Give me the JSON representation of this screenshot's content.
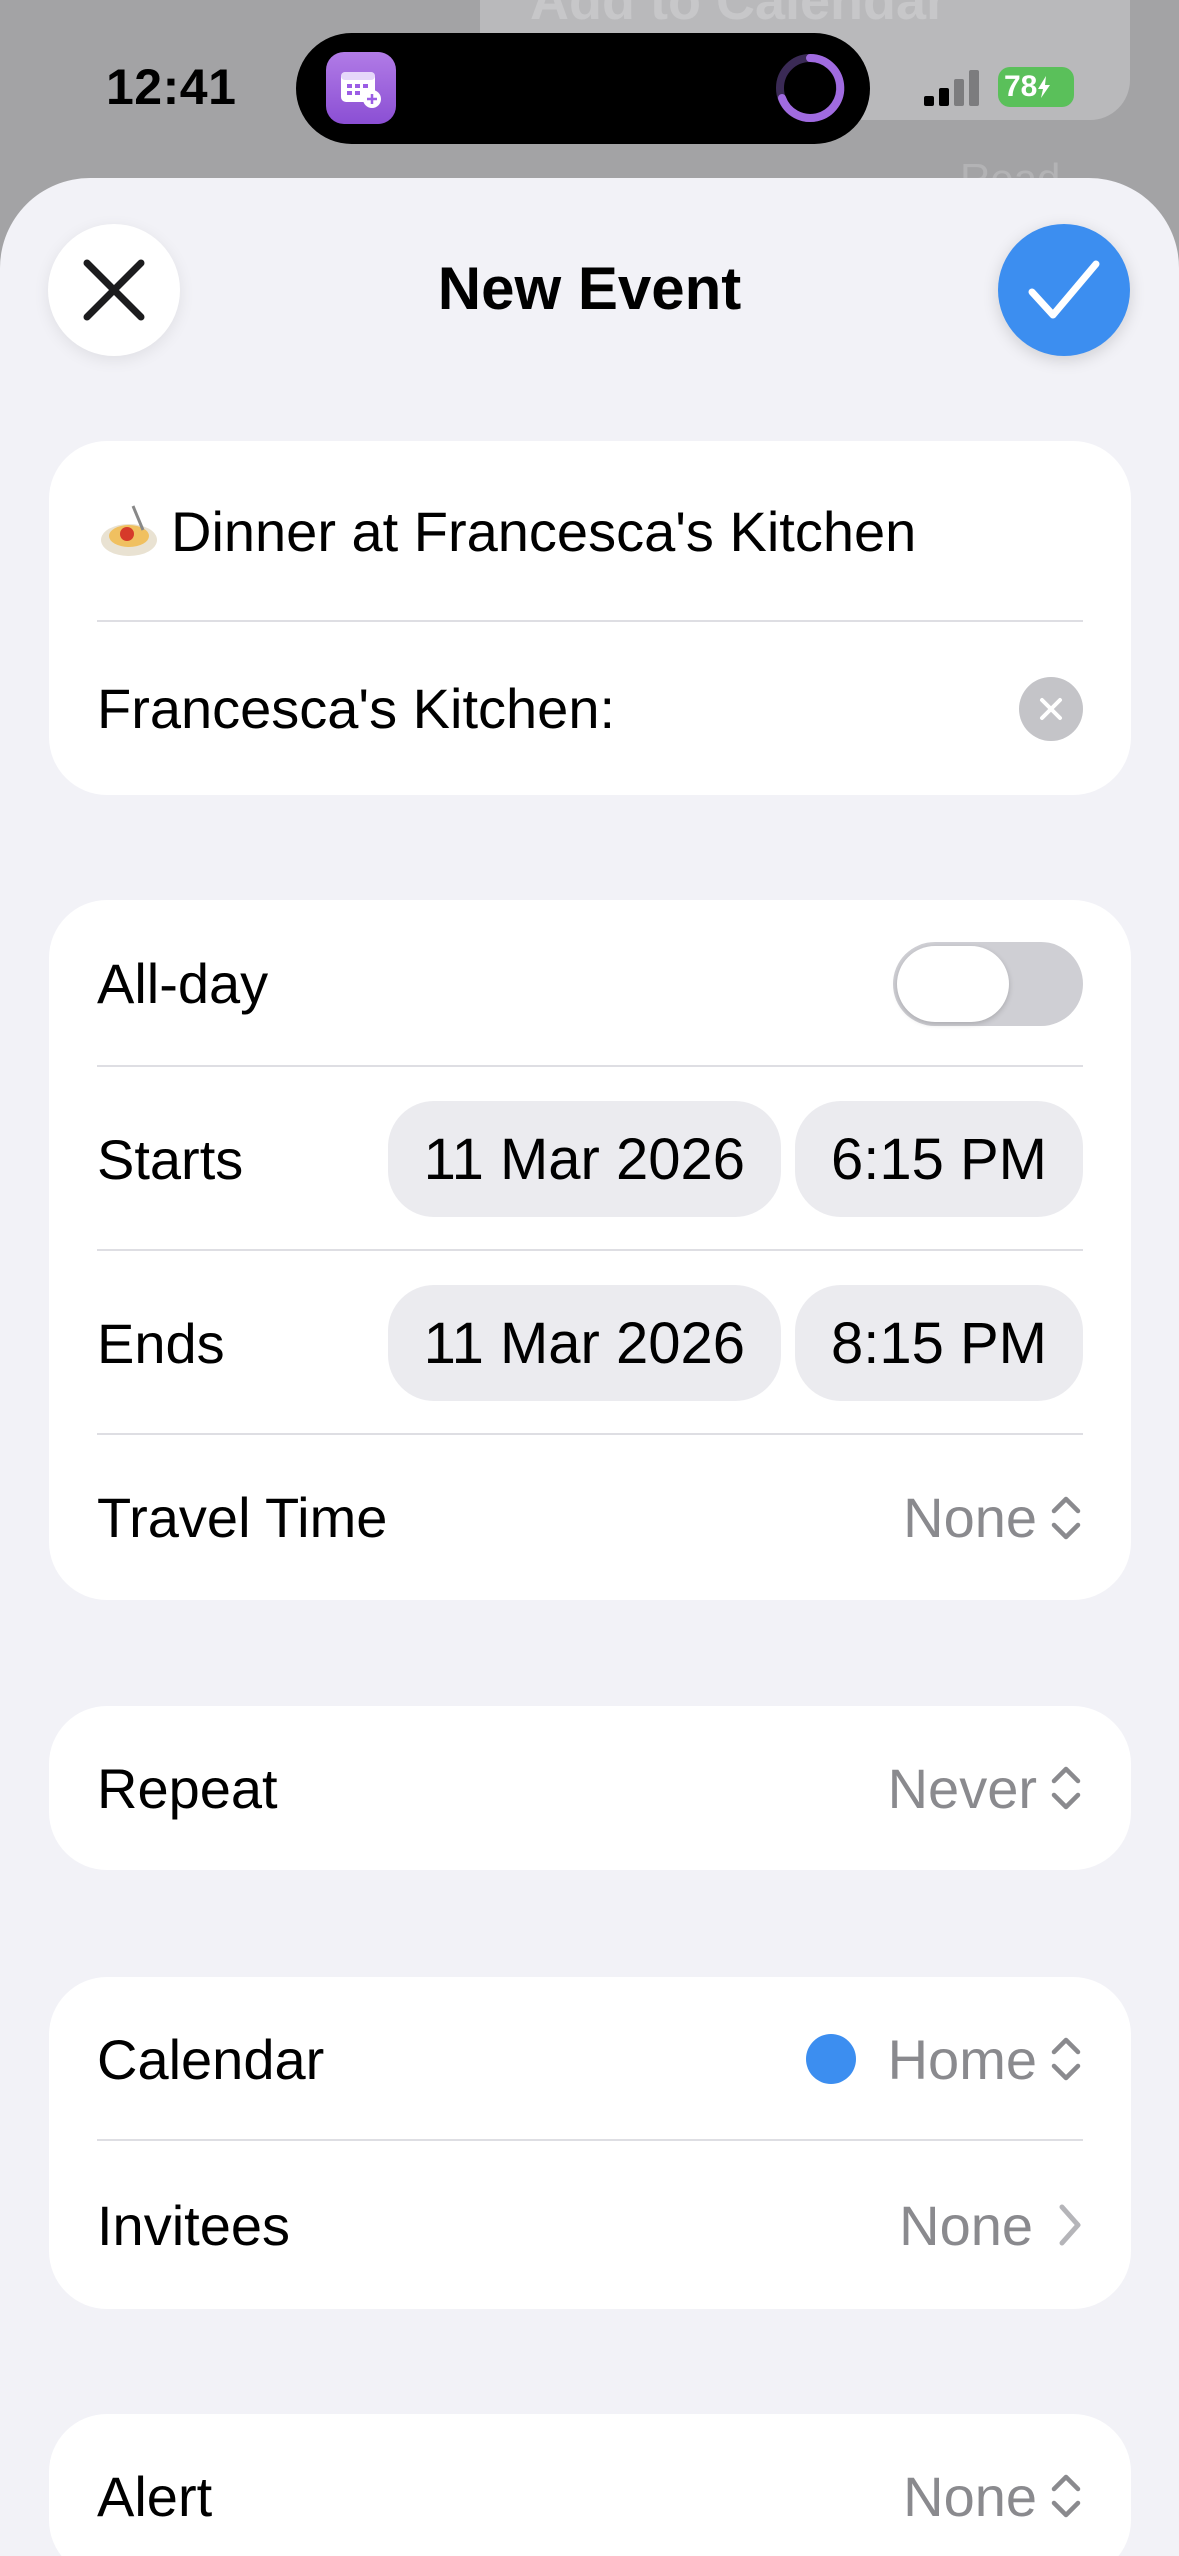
{
  "status_bar": {
    "time": "12:41",
    "battery": "78"
  },
  "background": {
    "ghost_text": "Add to Calendar",
    "ghost_sub": "Read"
  },
  "header": {
    "title": "New Event",
    "close_icon": "close-icon",
    "confirm_icon": "checkmark-icon"
  },
  "event": {
    "title": "Dinner at Francesca's Kitchen",
    "title_emoji": "spaghetti-icon",
    "location": "Francesca's Kitchen:"
  },
  "timing": {
    "all_day_label": "All-day",
    "all_day_on": false,
    "starts_label": "Starts",
    "starts_date": "11 Mar 2026",
    "starts_time": "6:15 PM",
    "ends_label": "Ends",
    "ends_date": "11 Mar 2026",
    "ends_time": "8:15 PM",
    "travel_label": "Travel Time",
    "travel_value": "None"
  },
  "repeat": {
    "label": "Repeat",
    "value": "Never"
  },
  "calendar": {
    "label": "Calendar",
    "value": "Home",
    "color": "#3c8ef0",
    "invitees_label": "Invitees",
    "invitees_value": "None"
  },
  "alert": {
    "label": "Alert",
    "value": "None"
  },
  "colors": {
    "accent": "#3c8ef0",
    "app_icon": "#9b5de5",
    "battery": "#5ac05a"
  }
}
